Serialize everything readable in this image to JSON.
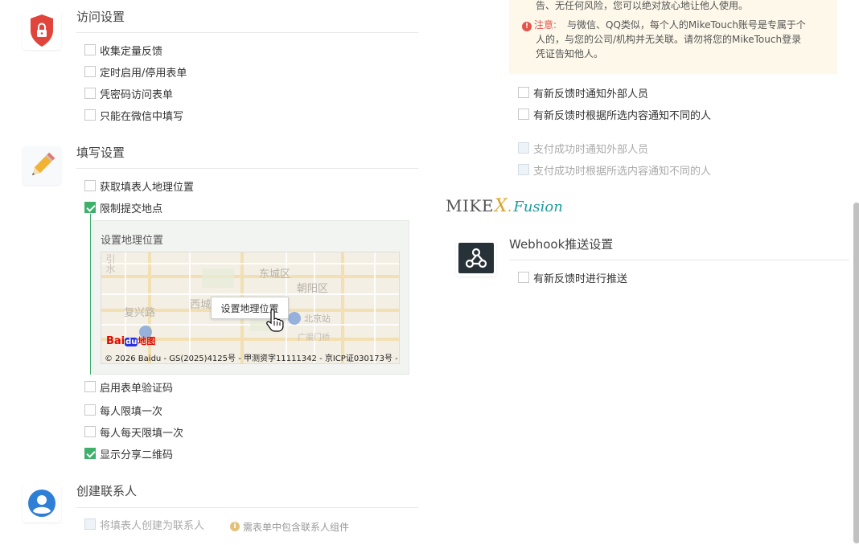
{
  "notice": {
    "top_line": "告、无任何风险，您可以绝对放心地让他人使用。",
    "label": "注意:",
    "line1": "与微信、QQ类似，每个人的MikeTouch账号是专属于个",
    "line2": "人的，与您的公司/机构并无关联。请勿将您的MikeTouch登录",
    "line3": "凭证告知他人。"
  },
  "access": {
    "title": "访问设置",
    "options": [
      {
        "label": "收集定量反馈",
        "checked": false
      },
      {
        "label": "定时启用/停用表单",
        "checked": false
      },
      {
        "label": "凭密码访问表单",
        "checked": false
      },
      {
        "label": "只能在微信中填写",
        "checked": false
      }
    ]
  },
  "fill": {
    "title": "填写设置",
    "options_top": [
      {
        "label": "获取填表人地理位置",
        "checked": false
      },
      {
        "label": "限制提交地点",
        "checked": true
      }
    ],
    "map": {
      "heading": "设置地理位置",
      "button": "设置地理位置",
      "places": [
        "东城区",
        "朝阳区",
        "西城",
        "复兴路",
        "北京站",
        "广渠门桥",
        "引水"
      ],
      "logo_bai": "Bai",
      "logo_du": "du",
      "logo_map": "地图",
      "copyright": "© 2026 Baidu - GS(2025)4125号 - 甲测资字11111342 - 京ICP证030173号 - D"
    },
    "options_bottom": [
      {
        "label": "启用表单验证码",
        "checked": false
      },
      {
        "label": "每人限填一次",
        "checked": false
      },
      {
        "label": "每人每天限填一次",
        "checked": false
      },
      {
        "label": "显示分享二维码",
        "checked": true
      }
    ]
  },
  "contact": {
    "title": "创建联系人",
    "option": "将填表人创建为联系人",
    "hint": "需表单中包含联系人组件"
  },
  "notify": {
    "options": [
      {
        "label": "有新反馈时通知外部人员",
        "checked": false
      },
      {
        "label": "有新反馈时根据所选内容通知不同的人",
        "checked": false
      }
    ],
    "pay_options": [
      {
        "label": "支付成功时通知外部人员"
      },
      {
        "label": "支付成功时根据所选内容通知不同的人"
      }
    ]
  },
  "brand": {
    "mike": "MIKE",
    "x": "X",
    "dot": ".",
    "fusion": "Fusion"
  },
  "webhook": {
    "title": "Webhook推送设置",
    "option": "有新反馈时进行推送"
  },
  "colors": {
    "accent": "#3db16b",
    "shield": "#e0443a",
    "avatar": "#2f7fd6",
    "warning": "#e5534b",
    "notice_bg": "#fdf8ea"
  }
}
